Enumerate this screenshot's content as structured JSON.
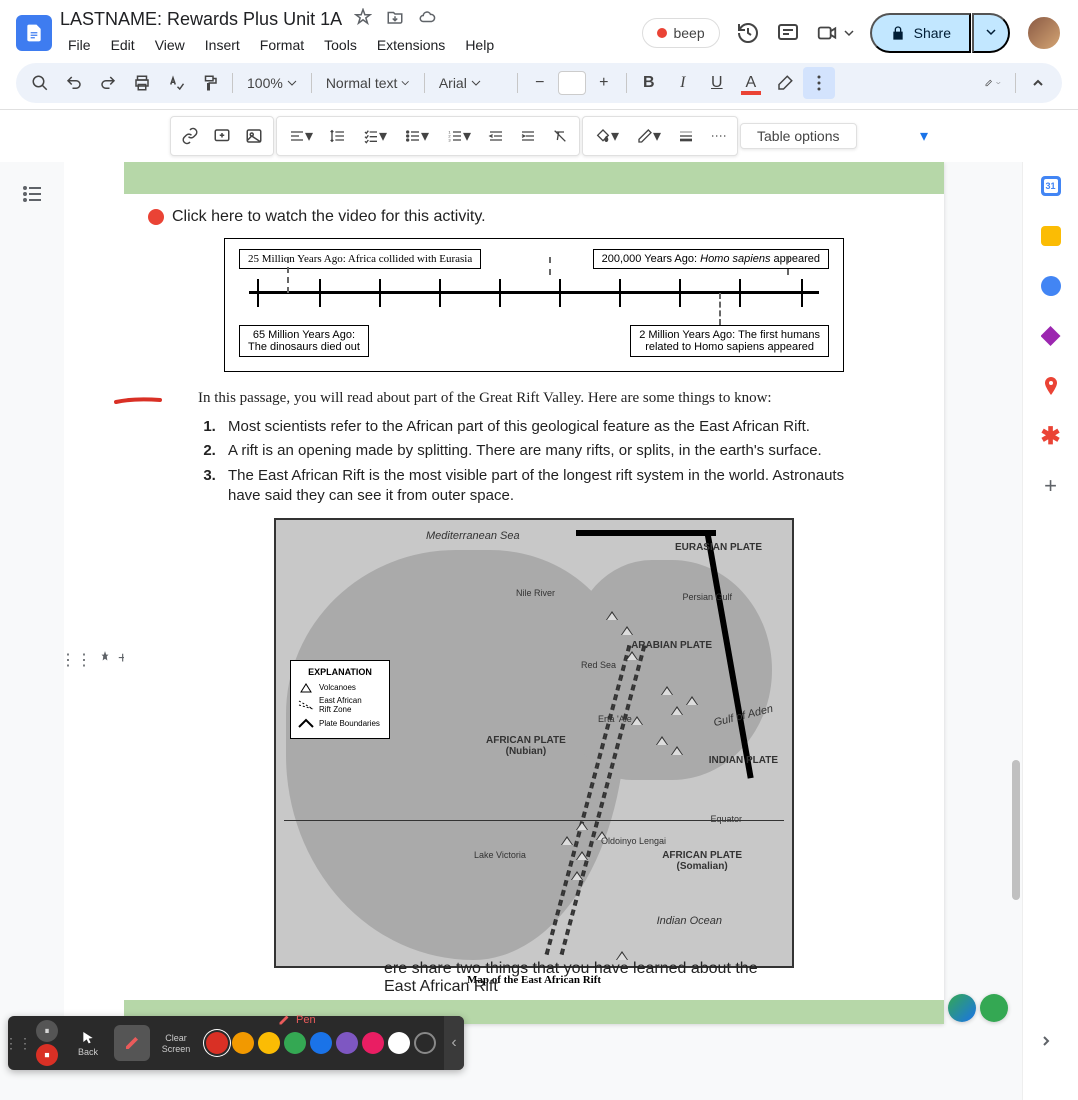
{
  "doc_title": "LASTNAME: Rewards Plus Unit 1A",
  "menus": [
    "File",
    "Edit",
    "View",
    "Insert",
    "Format",
    "Tools",
    "Extensions",
    "Help"
  ],
  "beep_label": "beep",
  "share_label": "Share",
  "toolbar": {
    "zoom": "100%",
    "style": "Normal text",
    "font": "Arial",
    "font_size": "",
    "bold": "B",
    "italic": "I",
    "underline": "U",
    "table_options": "Table options"
  },
  "content": {
    "video_link": "Click here to watch the video for this activity.",
    "timeline": {
      "top_left": "25 Million Years Ago: Africa collided with Eurasia",
      "top_right_prefix": "200,000 Years Ago: ",
      "top_right_italic": "Homo sapiens",
      "top_right_suffix": " appeared",
      "bot_left_l1": "65 Million Years Ago:",
      "bot_left_l2": "The dinosaurs died out",
      "bot_right_l1": "2 Million Years Ago: The first humans",
      "bot_right_l2": "related to Homo sapiens appeared"
    },
    "intro": "In this passage, you will read about part of the Great Rift Valley. Here are some things to know:",
    "items": [
      "Most scientists refer to the African part of this geological feature as the East African Rift.",
      "A rift is an opening made by splitting. There are many rifts, or splits, in the earth's surface.",
      "The East African Rift is the most visible part of the longest rift system in the world. Astronauts have said they can see it from outer space."
    ],
    "map": {
      "med_sea": "Mediterranean Sea",
      "nile": "Nile River",
      "eurasian": "EURASIAN PLATE",
      "persian": "Persian Gulf",
      "arabian": "ARABIAN PLATE",
      "red_sea": "Red Sea",
      "erta": "Erta 'Ale",
      "gulf_aden": "Gulf of Aden",
      "african_nubian_l1": "AFRICAN PLATE",
      "african_nubian_l2": "(Nubian)",
      "indian": "INDIAN PLATE",
      "equator": "Equator",
      "oldoinyo": "Oldoinyo Lengai",
      "victoria": "Lake Victoria",
      "african_som_l1": "AFRICAN PLATE",
      "african_som_l2": "(Somalian)",
      "indian_ocean": "Indian Ocean",
      "caption": "Map of the East African Rift",
      "legend": {
        "title": "EXPLANATION",
        "volcanoes": "Volcanoes",
        "rift_l1": "East African",
        "rift_l2": "Rift Zone",
        "bounds": "Plate Boundaries"
      }
    },
    "prompt": "ere share two things that you have learned about the East African Rift"
  },
  "annotation_tools": {
    "back": "Back",
    "clear_l1": "Clear",
    "clear_l2": "Screen",
    "pen": "Pen",
    "colors": [
      "#d93025",
      "#f29900",
      "#fbbc04",
      "#34a853",
      "#1a73e8",
      "#7e57c2",
      "#e91e63",
      "#ffffff"
    ]
  }
}
